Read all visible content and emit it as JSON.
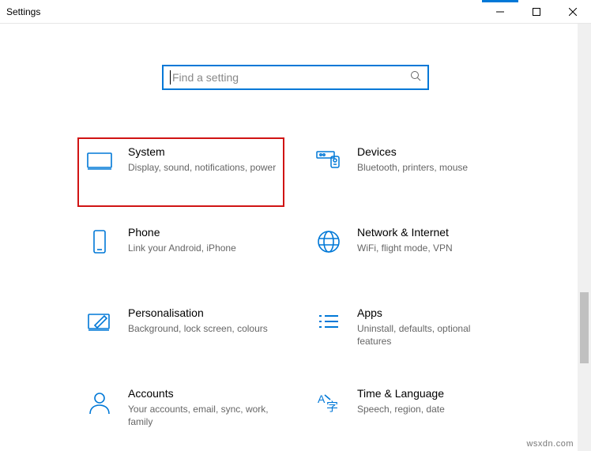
{
  "window": {
    "title": "Settings"
  },
  "search": {
    "placeholder": "Find a setting"
  },
  "tiles": {
    "system": {
      "title": "System",
      "sub": "Display, sound, notifications, power"
    },
    "devices": {
      "title": "Devices",
      "sub": "Bluetooth, printers, mouse"
    },
    "phone": {
      "title": "Phone",
      "sub": "Link your Android, iPhone"
    },
    "network": {
      "title": "Network & Internet",
      "sub": "WiFi, flight mode, VPN"
    },
    "personal": {
      "title": "Personalisation",
      "sub": "Background, lock screen, colours"
    },
    "apps": {
      "title": "Apps",
      "sub": "Uninstall, defaults, optional features"
    },
    "accounts": {
      "title": "Accounts",
      "sub": "Your accounts, email, sync, work, family"
    },
    "time": {
      "title": "Time & Language",
      "sub": "Speech, region, date"
    }
  },
  "watermark": "wsxdn.com"
}
